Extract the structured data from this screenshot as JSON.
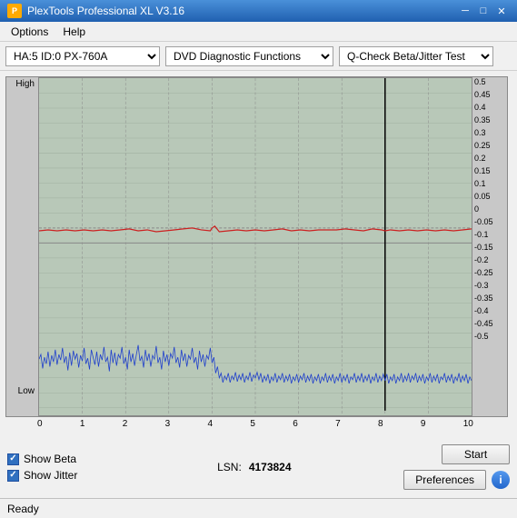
{
  "titleBar": {
    "title": "PlexTools Professional XL V3.16",
    "icon": "P",
    "controls": {
      "minimize": "─",
      "maximize": "□",
      "close": "✕"
    }
  },
  "menuBar": {
    "items": [
      "Options",
      "Help"
    ]
  },
  "toolbar": {
    "driveSelect": {
      "value": "HA:5 ID:0  PX-760A",
      "options": [
        "HA:5 ID:0  PX-760A"
      ]
    },
    "functionSelect": {
      "value": "DVD Diagnostic Functions",
      "options": [
        "DVD Diagnostic Functions"
      ]
    },
    "testSelect": {
      "value": "Q-Check Beta/Jitter Test",
      "options": [
        "Q-Check Beta/Jitter Test"
      ]
    }
  },
  "chart": {
    "yLeftLabels": [
      "High",
      "Low"
    ],
    "yRightLabels": [
      "0.5",
      "0.45",
      "0.4",
      "0.35",
      "0.3",
      "0.25",
      "0.2",
      "0.15",
      "0.1",
      "0.05",
      "0",
      "-0.05",
      "-0.1",
      "-0.15",
      "-0.2",
      "-0.25",
      "-0.3",
      "-0.35",
      "-0.4",
      "-0.45",
      "-0.5"
    ],
    "xLabels": [
      "0",
      "1",
      "2",
      "3",
      "4",
      "5",
      "6",
      "7",
      "8",
      "9",
      "10"
    ]
  },
  "bottomPanel": {
    "showBeta": {
      "label": "Show Beta",
      "checked": true
    },
    "showJitter": {
      "label": "Show Jitter",
      "checked": true
    },
    "lsn": {
      "label": "LSN:",
      "value": "4173824"
    },
    "startButton": "Start",
    "preferencesButton": "Preferences",
    "infoIcon": "i"
  },
  "statusBar": {
    "text": "Ready"
  }
}
